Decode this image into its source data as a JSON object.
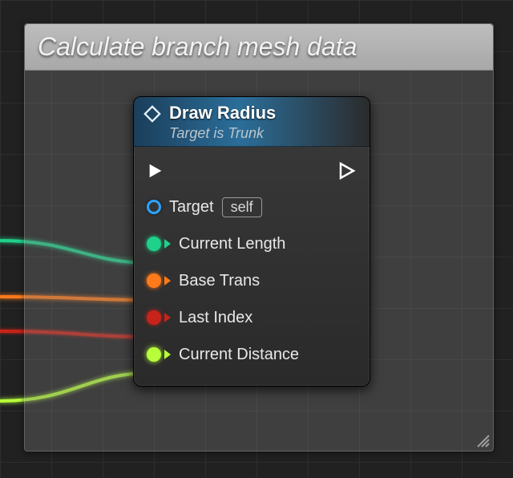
{
  "comment": {
    "title": "Calculate branch mesh data"
  },
  "node": {
    "title": "Draw Radius",
    "subtitle": "Target is Trunk",
    "target_label": "Target",
    "target_value": "self",
    "pins": [
      {
        "label": "Current Length",
        "color": "#1fd18a"
      },
      {
        "label": "Base Trans",
        "color": "#ff7a1a"
      },
      {
        "label": "Last Index",
        "color": "#c8231a"
      },
      {
        "label": "Current Distance",
        "color": "#b6ff3a"
      }
    ]
  },
  "colors": {
    "target_pin": "#2aa4ff",
    "wire_teal": "#1fd18a",
    "wire_orange": "#ff7a1a",
    "wire_red": "#c8231a",
    "wire_lime": "#b6ff3a"
  }
}
